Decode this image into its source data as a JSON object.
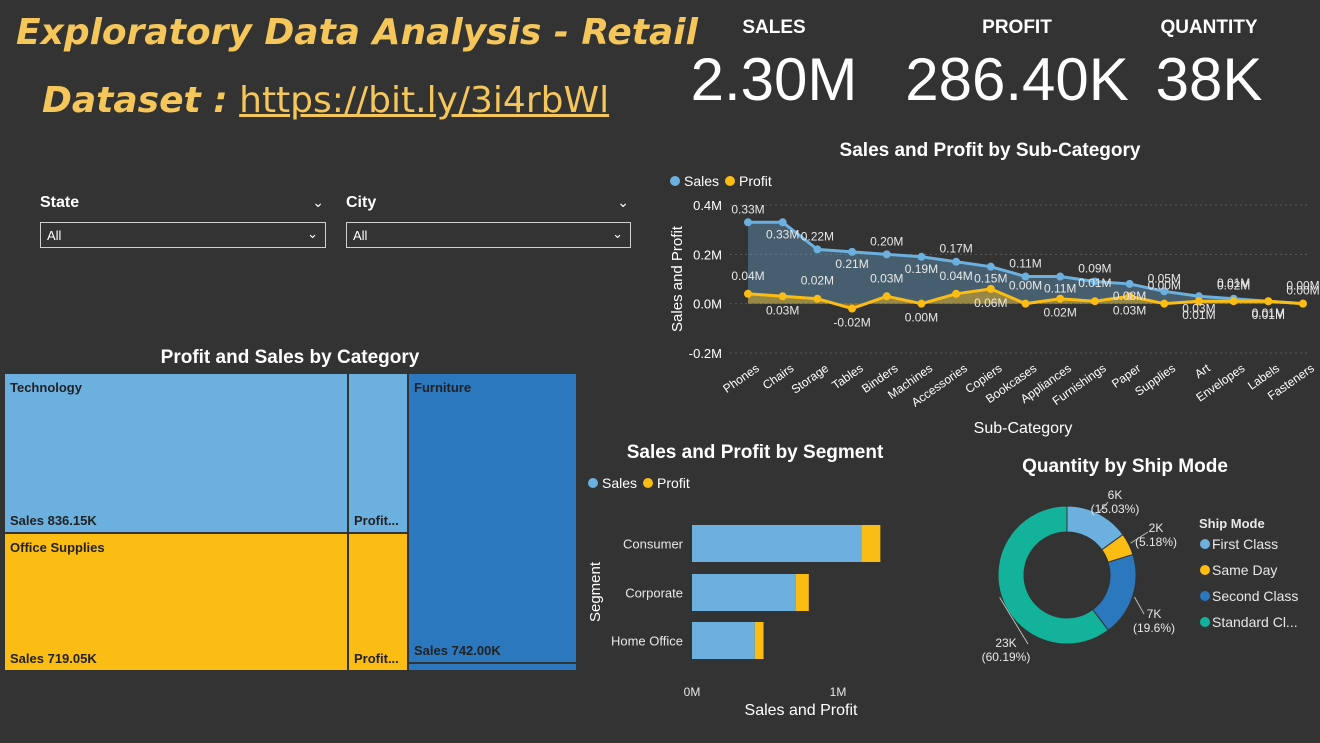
{
  "header": {
    "title": "Exploratory Data Analysis - Retail",
    "dataset_label": "Dataset :",
    "dataset_link": "https://bit.ly/3i4rbWl"
  },
  "kpis": [
    {
      "label": "SALES",
      "value": "2.30M"
    },
    {
      "label": "PROFIT",
      "value": "286.40K"
    },
    {
      "label": "QUANTITY",
      "value": "38K"
    }
  ],
  "filters": {
    "state": {
      "title": "State",
      "value": "All"
    },
    "city": {
      "title": "City",
      "value": "All"
    }
  },
  "colors": {
    "background": "#333333",
    "title": "#f5c65a",
    "sales": "#6cb0e0",
    "profit": "#fbbc14",
    "furniture": "#2b78bf",
    "standard": "#12b39a",
    "second": "#2b78bf"
  },
  "chart_data": [
    {
      "type": "line",
      "title": "Sales and Profit by Sub-Category",
      "xlabel": "Sub-Category",
      "ylabel": "Sales and Profit",
      "legend": "top-left",
      "grid": true,
      "ylim": [
        -0.2,
        0.4
      ],
      "yticks": [
        "0.4M",
        "0.2M",
        "0.0M",
        "-0.2M"
      ],
      "categories": [
        "Phones",
        "Chairs",
        "Storage",
        "Tables",
        "Binders",
        "Machines",
        "Accessories",
        "Copiers",
        "Bookcases",
        "Appliances",
        "Furnishings",
        "Paper",
        "Supplies",
        "Art",
        "Envelopes",
        "Labels",
        "Fasteners"
      ],
      "series": [
        {
          "name": "Sales",
          "values": [
            0.33,
            0.33,
            0.22,
            0.21,
            0.2,
            0.19,
            0.17,
            0.15,
            0.11,
            0.11,
            0.09,
            0.08,
            0.05,
            0.03,
            0.02,
            0.01,
            0.0
          ],
          "labels": [
            "0.33M",
            "0.33M",
            "0.22M",
            "0.21M",
            "0.20M",
            "0.19M",
            "0.17M",
            "0.15M",
            "0.11M",
            "0.11M",
            "0.09M",
            "0.08M",
            "0.05M",
            "0.03M",
            "0.02M",
            "0.01M",
            "0.00M"
          ]
        },
        {
          "name": "Profit",
          "values": [
            0.04,
            0.03,
            0.02,
            -0.02,
            0.03,
            0.0,
            0.04,
            0.06,
            0.0,
            0.02,
            0.01,
            0.03,
            0.0,
            0.01,
            0.01,
            0.01,
            0.0
          ],
          "labels": [
            "0.04M",
            "0.03M",
            "0.02M",
            "-0.02M",
            "0.03M",
            "0.00M",
            "0.04M",
            "0.06M",
            "0.00M",
            "0.02M",
            "0.01M",
            "0.03M",
            "0.00M",
            "0.01M",
            "0.01M",
            "0.01M",
            "0.00M"
          ]
        }
      ]
    },
    {
      "type": "treemap",
      "title": "Profit and Sales by Category",
      "items": [
        {
          "name": "Technology",
          "sales": 836.15,
          "sales_label": "Sales 836.15K",
          "profit_label": "Profit..."
        },
        {
          "name": "Office Supplies",
          "sales": 719.05,
          "sales_label": "Sales 719.05K",
          "profit_label": "Profit..."
        },
        {
          "name": "Furniture",
          "sales": 742.0,
          "sales_label": "Sales 742.00K"
        }
      ]
    },
    {
      "type": "bar",
      "orientation": "horizontal",
      "stacked": true,
      "title": "Sales and Profit by Segment",
      "xlabel": "Sales and Profit",
      "ylabel": "Segment",
      "legend": "top-left",
      "xlim": [
        0,
        1.3
      ],
      "xticks": [
        "0M",
        "1M"
      ],
      "categories": [
        "Consumer",
        "Corporate",
        "Home Office"
      ],
      "series": [
        {
          "name": "Sales",
          "values": [
            1.16,
            0.71,
            0.43
          ]
        },
        {
          "name": "Profit",
          "values": [
            0.13,
            0.09,
            0.06
          ]
        }
      ]
    },
    {
      "type": "pie",
      "donut": true,
      "title": "Quantity by Ship Mode",
      "legend_title": "Ship Mode",
      "legend": "right",
      "slices": [
        {
          "name": "First Class",
          "legend_label": "First Class",
          "value": 15.03,
          "label": "6K",
          "pct": "(15.03%)"
        },
        {
          "name": "Same Day",
          "legend_label": "Same Day",
          "value": 5.18,
          "label": "2K",
          "pct": "(5.18%)"
        },
        {
          "name": "Second Class",
          "legend_label": "Second Class",
          "value": 19.6,
          "label": "7K",
          "pct": "(19.6%)"
        },
        {
          "name": "Standard Class",
          "legend_label": "Standard Cl...",
          "value": 60.19,
          "label": "23K",
          "pct": "(60.19%)"
        }
      ]
    }
  ]
}
